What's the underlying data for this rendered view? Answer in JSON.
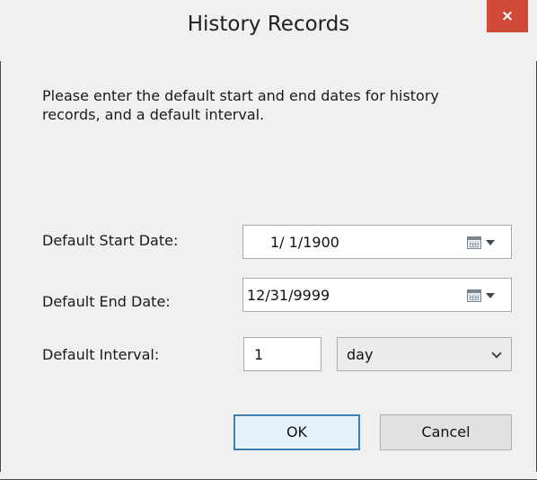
{
  "dialog": {
    "title": "History Records",
    "close_label": "×",
    "instructions": "Please enter the default start and end dates for history records, and a default interval."
  },
  "start_date": {
    "label": "Default Start Date:",
    "value": "1/  1/1900",
    "icon": "calendar-icon"
  },
  "end_date": {
    "label": "Default End Date:",
    "value": "12/31/9999",
    "icon": "calendar-icon"
  },
  "interval": {
    "label": "Default Interval:",
    "value": "1",
    "unit_selected": "day"
  },
  "buttons": {
    "ok": "OK",
    "cancel": "Cancel"
  },
  "colors": {
    "close_button": "#d04a3a",
    "default_button_border": "#3c7fb1",
    "background": "#f0f0f0"
  }
}
